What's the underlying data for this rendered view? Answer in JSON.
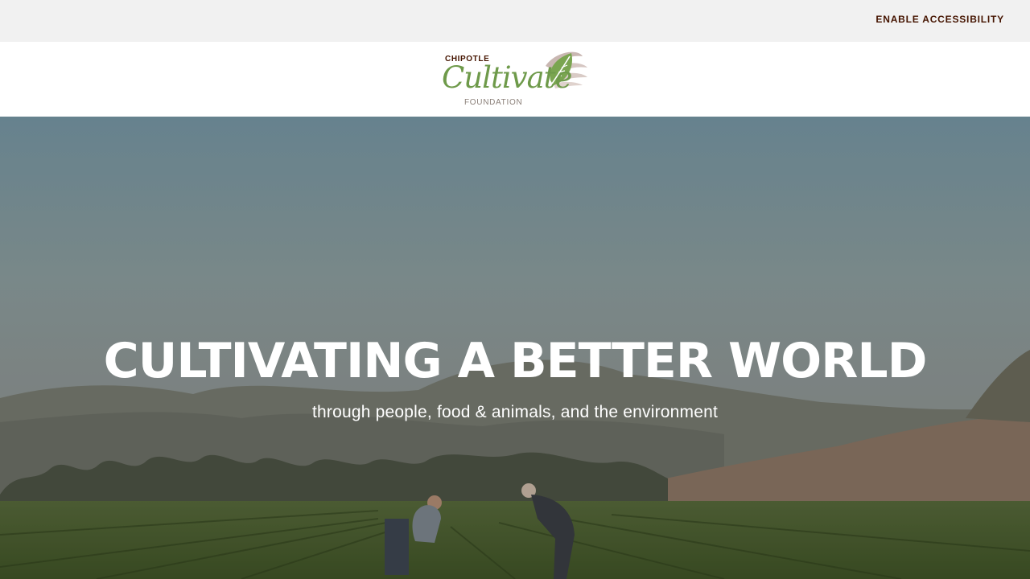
{
  "topbar": {
    "accessibility_label": "ENABLE ACCESSIBILITY"
  },
  "logo": {
    "brand": "CHIPOTLE",
    "wordmark": "Cultivate",
    "suffix": "FOUNDATION",
    "leaf_icon": "leaf-icon",
    "accent_color": "#6e9a4a",
    "wing_color": "#c9b7b2"
  },
  "hero": {
    "title": "CULTIVATING A BETTER WORLD",
    "subtitle": "through people, food & animals, and the environment"
  }
}
